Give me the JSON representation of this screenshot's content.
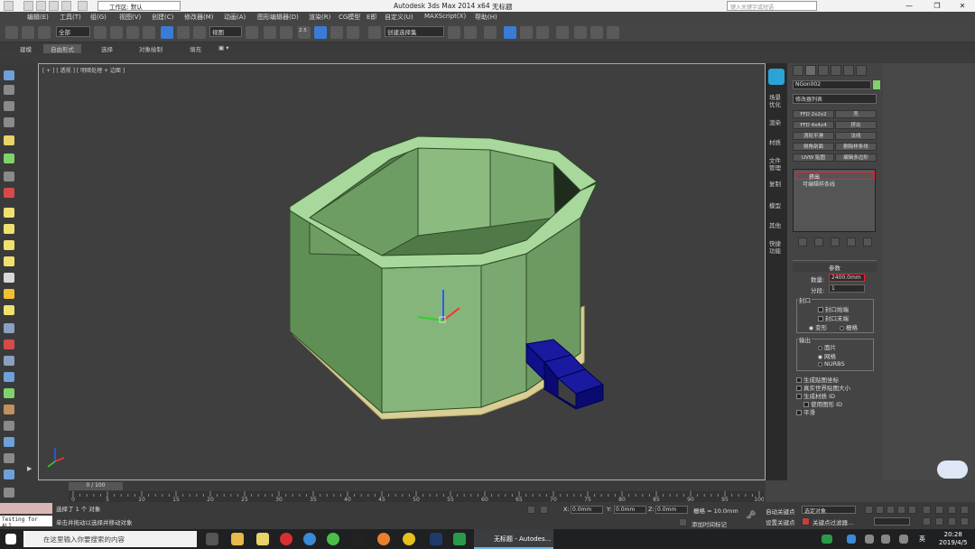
{
  "title": {
    "app": "Autodesk 3ds Max  2014 x64",
    "doc": "无标题",
    "workspace": "工作区: 默认",
    "search_placeholder": "键入关键字或短语"
  },
  "menu": [
    "编辑(E)",
    "工具(T)",
    "组(G)",
    "视图(V)",
    "创建(C)",
    "修改器(M)",
    "动画(A)",
    "图形编辑器(D)",
    "渲染(R)",
    "CG模型",
    "E即",
    "自定义(U)",
    "MAXScript(X)",
    "帮助(H)"
  ],
  "toolbar": {
    "selection_filter": "全部",
    "ref_coord": "视图",
    "named_sel": "创建选择集",
    "snap_value": "2.5"
  },
  "ribbon": [
    "建模",
    "自由形式",
    "选择",
    "对象绘制",
    "填充"
  ],
  "viewport": {
    "label": "[ + ] [ 透视 ] [ 明暗处理 + 边面 ]"
  },
  "right_bar": [
    "场景优化",
    "渲染",
    "材质",
    "文件管理",
    "复制",
    "模型",
    "其他",
    "快捷功能"
  ],
  "command_panel": {
    "object_name": "NGon002",
    "object_color": "#7fd36a",
    "modifier_list": "修改器列表",
    "modifier_buttons": [
      [
        "FFD 2x2x2",
        "壳"
      ],
      [
        "FFD 4x4x4",
        "挤出"
      ],
      [
        "涡轮平滑",
        "法线"
      ],
      [
        "倒角剖面",
        "删除样条线"
      ],
      [
        "UVW 贴图",
        "编辑多边形"
      ]
    ],
    "stack": [
      "挤出",
      "可编辑样条线"
    ],
    "params_header": "参数",
    "amount_label": "数量:",
    "amount_value": "2400.0mm",
    "segments_label": "分段:",
    "segments_value": "1",
    "capping": {
      "label": "封口",
      "start": "封口始端",
      "end": "封口末端",
      "morph": "变形",
      "grid": "栅格"
    },
    "output": {
      "label": "输出",
      "patch": "面片",
      "mesh": "网格",
      "nurbs": "NURBS"
    },
    "options": [
      "生成贴图坐标",
      "真实世界贴图大小",
      "生成材质 ID",
      "使用图形 ID",
      "平滑"
    ]
  },
  "timeline": {
    "slider": "0 / 100",
    "ticks": [
      "0",
      "5",
      "10",
      "15",
      "20",
      "25",
      "30",
      "35",
      "40",
      "45",
      "50",
      "55",
      "60",
      "65",
      "70",
      "75",
      "80",
      "85",
      "90",
      "95",
      "100"
    ]
  },
  "status": {
    "selected": "选择了 1 个 对象",
    "prompt": "单击并拖动以选择并移动对象",
    "maxscript": "Testing for ALI",
    "x_label": "X:",
    "x_value": "0.0mm",
    "y_label": "Y:",
    "y_value": "0.0mm",
    "z_label": "Z:",
    "z_value": "0.0mm",
    "grid": "栅格 = 10.0mm",
    "add_time_tag": "添加时间标记",
    "auto_key": "自动关键点",
    "auto_key_sel": "选定对象",
    "set_key": "设置关键点",
    "key_filters": "关键点过滤器..."
  },
  "taskbar": {
    "search_placeholder": "在这里输入你要搜索的内容",
    "active_app": "无标题 - Autodes...",
    "ime": "英",
    "time": "20:28",
    "date": "2019/4/5"
  }
}
